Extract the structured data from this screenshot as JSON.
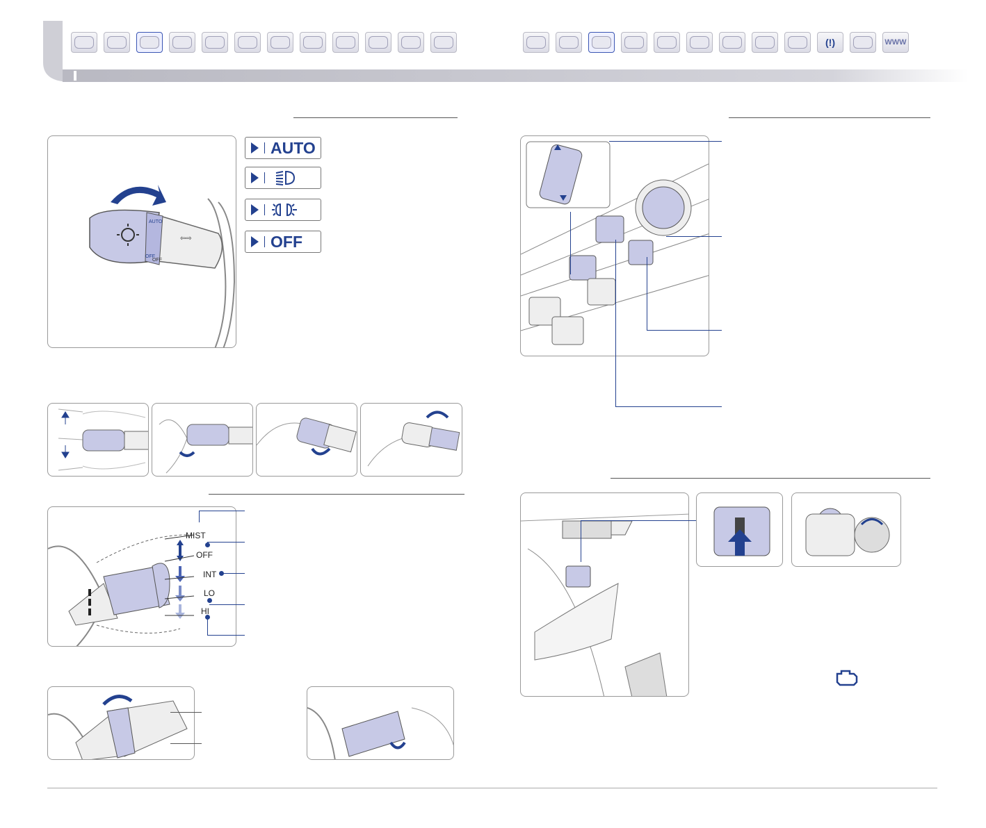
{
  "header": {
    "left_tabs": [
      "instrument-cluster",
      "car-exterior",
      "lights-lever",
      "gauges",
      "climate",
      "audio",
      "multimedia",
      "navigation",
      "wiper",
      "seat",
      "sunroof",
      "hand-phone"
    ],
    "right_tabs": [
      "steering-wheel",
      "engine-bay",
      "window-switch",
      "gauges",
      "climate",
      "audio",
      "navigation",
      "sunroof",
      "radio",
      "tire-pressure",
      "hand-phone",
      "www"
    ],
    "right_tab_text": {
      "www": "WWW",
      "tire": "(!)"
    }
  },
  "lights": {
    "modes": [
      {
        "label": "AUTO",
        "icon": "auto-text"
      },
      {
        "label": "",
        "icon": "high-beam-icon"
      },
      {
        "label": "",
        "icon": "parking-lights-icon"
      },
      {
        "label": "OFF",
        "icon": "off-text"
      }
    ]
  },
  "wiper": {
    "positions": [
      "MIST",
      "OFF",
      "INT",
      "LO",
      "HI"
    ]
  },
  "colors": {
    "accent": "#23418f",
    "panel_fill": "#c7c9e6",
    "line": "#555555"
  }
}
